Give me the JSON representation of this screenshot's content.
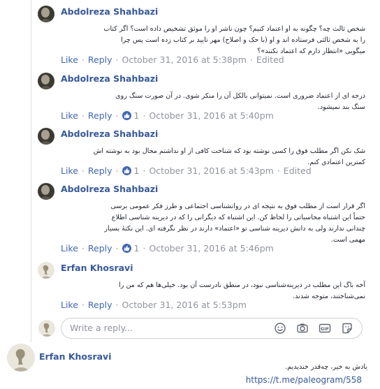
{
  "comments": [
    {
      "author": "Abdolreza Shahbazi",
      "lines": [
        "شخص ثالث چه؟ چگونه به او اعتماد کنیم؟ چون ناشر او را موثق تشخیص داده است؟ اگر کتاب",
        "را به شخص ثالثی فرستاده اند و او (با حک و اصلاح) مهر تایید بر کتاب زده است پس چرا",
        "میگویی «انتظار دارم که اعتماد نکنند»؟"
      ],
      "like": "Like",
      "reply": "Reply",
      "likes": "",
      "time": "October 31, 2016 at 5:38pm",
      "edited": "Edited"
    },
    {
      "author": "Abdolreza Shahbazi",
      "lines": [
        "درجه ای از اعتماد ضروری است. نمیتوانی بالکل آن را منکر شوی. در آن صورت سنگ روی",
        "سنگ بند نمیشود."
      ],
      "like": "Like",
      "reply": "Reply",
      "likes": "1",
      "time": "October 31, 2016 at 5:40pm",
      "edited": ""
    },
    {
      "author": "Abdolreza Shahbazi",
      "lines": [
        "شک نکن اگر مطلب فوق را کسی نوشته بود که شناخت کافی از او نداشتم محال بود به نوشته اش",
        "کمترین اعتمادی کنم."
      ],
      "like": "Like",
      "reply": "Reply",
      "likes": "1",
      "time": "October 31, 2016 at 5:43pm",
      "edited": "Edited"
    },
    {
      "author": "Abdolreza Shahbazi",
      "lines": [
        "اگر قرار است از مطلب فوق به نتیجه ای در روانشناسی اجتماعی و طرز فکر عمومی برسی",
        "حتماً این اشتباه محاسباتی را لحاظ کن. این اشتباه که دیگرانی را که در دیرینه شناسی اطلاع",
        "چندانی ندارند ولی به دانش دیرینه شناسی تو «اعتماد» دارند در نظر نگرفته ای. این نکتهٔ بسیار",
        "مهمی است."
      ],
      "like": "Like",
      "reply": "Reply",
      "likes": "1",
      "time": "October 31, 2016 at 5:46pm",
      "edited": ""
    },
    {
      "author": "Erfan Khosravi",
      "lines": [
        "آخه باگ این مطلب در دیرینه‌شناسی نبود، در منطق نادرست آن بود. خیلی‌ها هم که من را",
        "نمی‌شناختند، متوجه شدند."
      ],
      "like": "Like",
      "reply": "Reply",
      "likes": "",
      "time": "October 31, 2016 at 5:53pm",
      "edited": ""
    }
  ],
  "reply_box": {
    "placeholder": "Write a reply..."
  },
  "bottom_post": {
    "author": "Erfan Khosravi",
    "text": "یادش به خیر، چه‌قدر خندیدیم.",
    "link": "https://t.me/paleogram/558"
  },
  "colors": {
    "link": "#4267b2",
    "author": "#365899",
    "meta": "#90949c",
    "text": "#1d2129"
  }
}
